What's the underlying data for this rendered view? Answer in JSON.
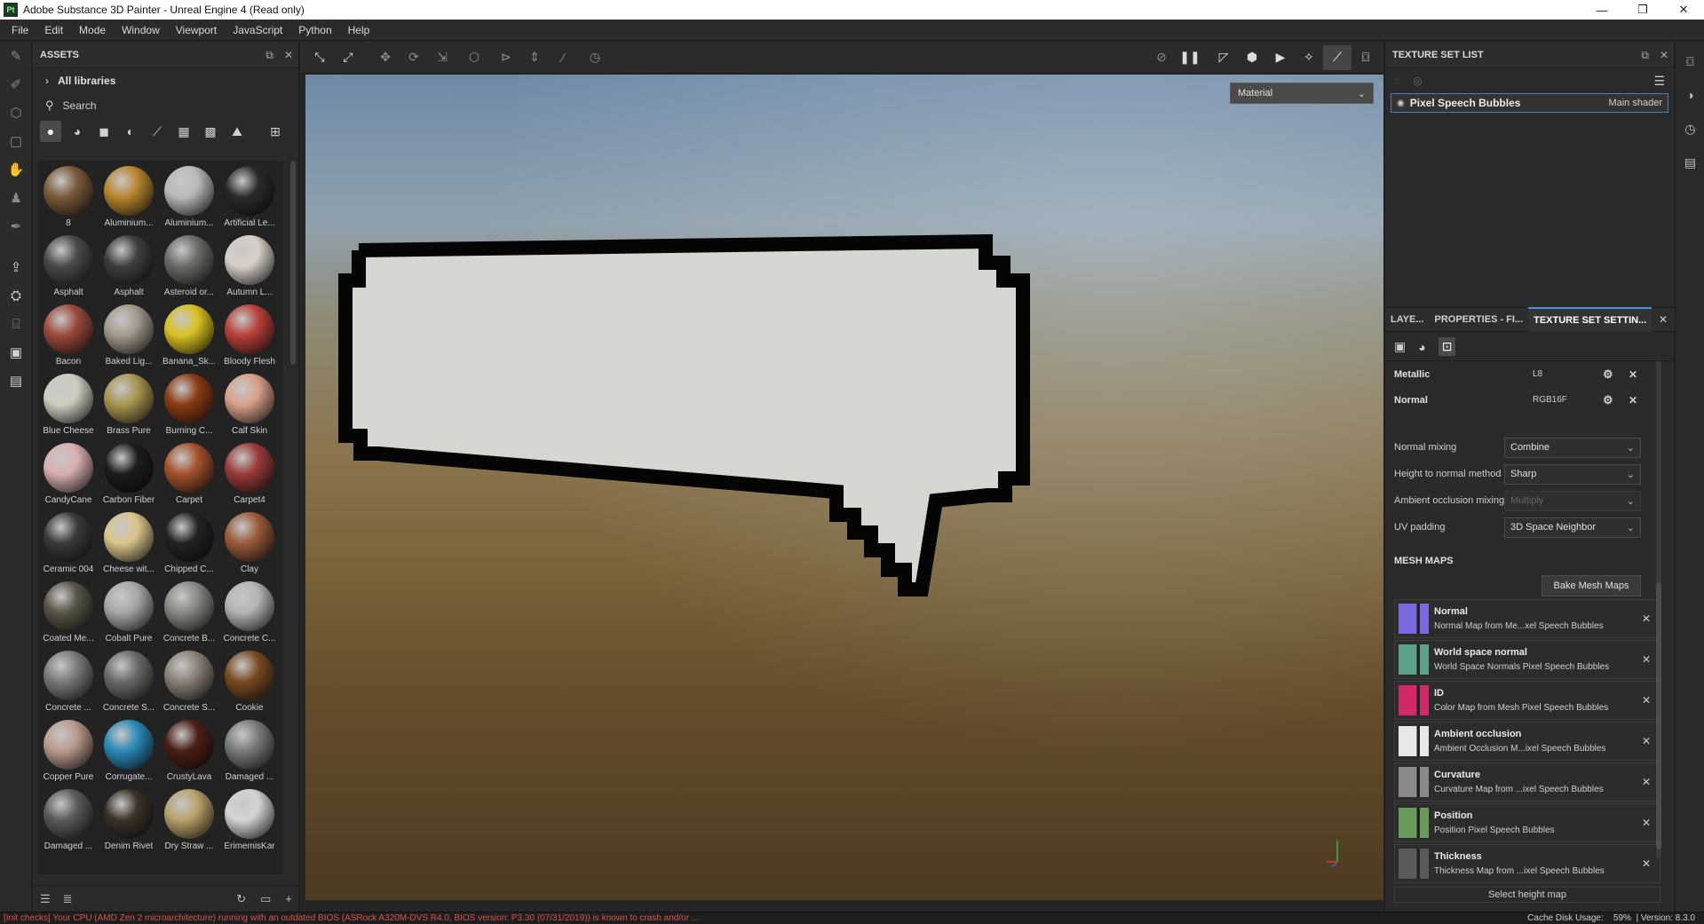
{
  "window": {
    "title": "Adobe Substance 3D Painter - Unreal Engine 4 (Read only)",
    "app_icon": "Pt",
    "controls": [
      "—",
      "❐",
      "✕"
    ]
  },
  "menu": [
    "File",
    "Edit",
    "Mode",
    "Window",
    "Viewport",
    "JavaScript",
    "Python",
    "Help"
  ],
  "assets": {
    "title": "ASSETS",
    "library": "All libraries",
    "search_placeholder": "Search",
    "items": [
      {
        "label": "8",
        "color": "#7a5a3a"
      },
      {
        "label": "Aluminium...",
        "color": "#b8862e"
      },
      {
        "label": "Aluminium...",
        "color": "#b9b9b9"
      },
      {
        "label": "Artificial Le...",
        "color": "#2a2a2a"
      },
      {
        "label": "Asphalt",
        "color": "#4a4a4a"
      },
      {
        "label": "Asphalt",
        "color": "#3e3e3e"
      },
      {
        "label": "Asteroid or...",
        "color": "#6b6b66"
      },
      {
        "label": "Autumn L...",
        "color": "#d8d0c8"
      },
      {
        "label": "Bacon",
        "color": "#9a4a3a"
      },
      {
        "label": "Baked Lig...",
        "color": "#a49a8c"
      },
      {
        "label": "Banana_Sk...",
        "color": "#d9c120"
      },
      {
        "label": "Bloody Flesh",
        "color": "#b8403a"
      },
      {
        "label": "Blue Cheese",
        "color": "#cfcdbf"
      },
      {
        "label": "Brass Pure",
        "color": "#a89650"
      },
      {
        "label": "Burning C...",
        "color": "#8a3a14"
      },
      {
        "label": "Calf Skin",
        "color": "#d9a08a"
      },
      {
        "label": "CandyCane",
        "color": "#d8b0b0"
      },
      {
        "label": "Carbon Fiber",
        "color": "#1c1c1c"
      },
      {
        "label": "Carpet",
        "color": "#a4522c"
      },
      {
        "label": "Carpet4",
        "color": "#9a3a3a"
      },
      {
        "label": "Ceramic 004",
        "color": "#3a3a3a"
      },
      {
        "label": "Cheese wit...",
        "color": "#d9c48a"
      },
      {
        "label": "Chipped C...",
        "color": "#222222"
      },
      {
        "label": "Clay",
        "color": "#9a5a3a"
      },
      {
        "label": "Coated Me...",
        "color": "#5a5446"
      },
      {
        "label": "Cobalt Pure",
        "color": "#a8a8a8"
      },
      {
        "label": "Concrete B...",
        "color": "#8a8882"
      },
      {
        "label": "Concrete C...",
        "color": "#b4b4b4"
      },
      {
        "label": "Concrete ...",
        "color": "#7a7a7a"
      },
      {
        "label": "Concrete S...",
        "color": "#6a6a6a"
      },
      {
        "label": "Concrete S...",
        "color": "#8a8076"
      },
      {
        "label": "Cookie",
        "color": "#7a4a22"
      },
      {
        "label": "Copper Pure",
        "color": "#b89a8a"
      },
      {
        "label": "Corrugate...",
        "color": "#2a8ab8"
      },
      {
        "label": "CrustyLava",
        "color": "#4a1e14"
      },
      {
        "label": "Damaged ...",
        "color": "#7a7a7a"
      },
      {
        "label": "Damaged ...",
        "color": "#5a5a5a"
      },
      {
        "label": "Denim Rivet",
        "color": "#3a3026"
      },
      {
        "label": "Dry Straw ...",
        "color": "#b8a06a"
      },
      {
        "label": "ErimemisKar",
        "color": "#d4d4d4"
      }
    ],
    "footer_icons": [
      "list-icon",
      "stack-icon",
      "refresh-icon",
      "folder-icon",
      "add-icon"
    ]
  },
  "viewport": {
    "mode_dropdown": "Material"
  },
  "texture_set_list": {
    "title": "TEXTURE SET LIST",
    "set_name": "Pixel Speech Bubbles",
    "shader": "Main shader"
  },
  "tabs": [
    "LAYE...",
    "PROPERTIES - FI...",
    "TEXTURE SET SETTIN..."
  ],
  "channels": [
    {
      "name": "Metallic",
      "format": "L8"
    },
    {
      "name": "Normal",
      "format": "RGB16F"
    }
  ],
  "settings": [
    {
      "label": "Normal mixing",
      "value": "Combine",
      "disabled": false
    },
    {
      "label": "Height to normal method",
      "value": "Sharp",
      "disabled": false
    },
    {
      "label": "Ambient occlusion mixing",
      "value": "Multiply",
      "disabled": true
    },
    {
      "label": "UV padding",
      "value": "3D Space Neighbor",
      "disabled": false
    }
  ],
  "mesh_maps": {
    "title": "MESH MAPS",
    "bake_label": "Bake Mesh Maps",
    "items": [
      {
        "name": "Normal",
        "desc": "Normal Map from Me...xel Speech Bubbles",
        "color": "#7a6ae0"
      },
      {
        "name": "World space normal",
        "desc": "World Space Normals Pixel Speech Bubbles",
        "color": "#5aa08a"
      },
      {
        "name": "ID",
        "desc": "Color Map from Mesh Pixel Speech Bubbles",
        "color": "#d02a6a"
      },
      {
        "name": "Ambient occlusion",
        "desc": "Ambient Occlusion M...ixel Speech Bubbles",
        "color": "#e8e8e8"
      },
      {
        "name": "Curvature",
        "desc": "Curvature Map from ...ixel Speech Bubbles",
        "color": "#8a8a8a"
      },
      {
        "name": "Position",
        "desc": "Position Pixel Speech Bubbles",
        "color": "#6a9a5a"
      },
      {
        "name": "Thickness",
        "desc": "Thickness Map from ...ixel Speech Bubbles",
        "color": "#5a5a5a"
      }
    ],
    "select_height": "Select height map"
  },
  "status": {
    "error": "[Init checks] Your CPU (AMD Zen 2 microarchitecture) running with an outdated BIOS (ASRock A320M-DVS R4.0, BIOS version: P3.30 (07/31/2019)) is known to crash and/or ...",
    "cache_label": "Cache Disk Usage:",
    "cache_value": "59%",
    "version": "| Version: 8.3.0"
  }
}
